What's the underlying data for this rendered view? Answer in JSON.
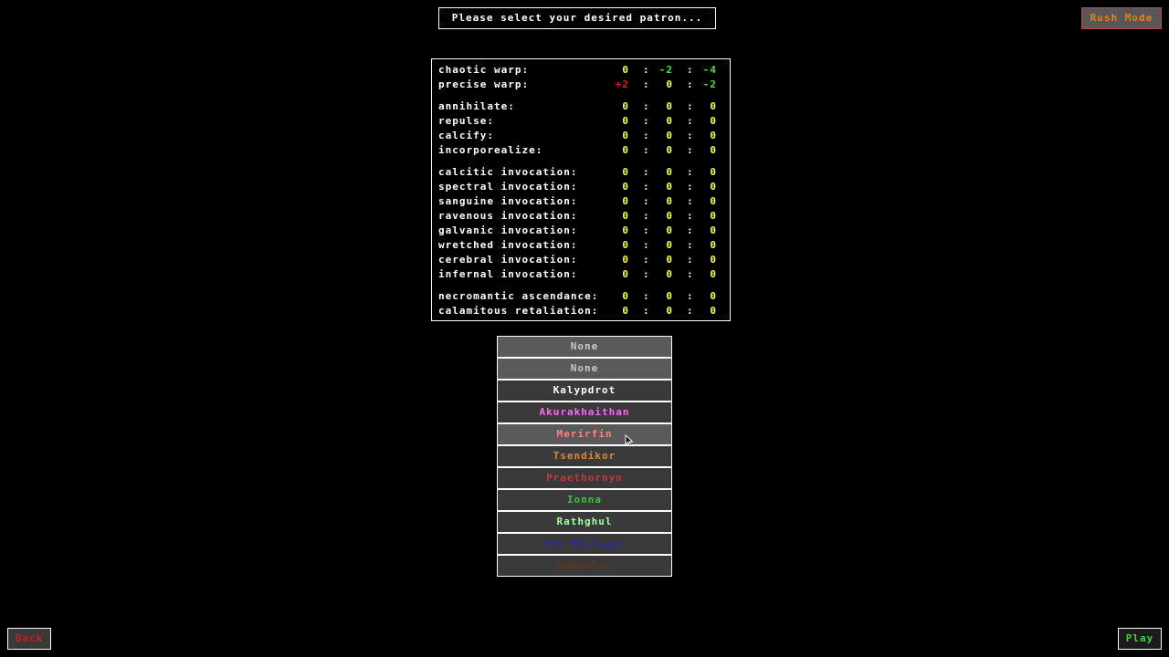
{
  "header": {
    "prompt": "Please select your desired patron...",
    "rush_mode_label": "Rush Mode"
  },
  "colors": {
    "zero": "#ffff40",
    "positive": "#e02020",
    "negative": "#40e040",
    "label": "#ffffff"
  },
  "stats": [
    {
      "label": "chaotic warp:",
      "values": [
        "0",
        "-2",
        "-4"
      ]
    },
    {
      "label": "precise warp:",
      "values": [
        "+2",
        "0",
        "-2"
      ]
    },
    {
      "label": "annihilate:",
      "values": [
        "0",
        "0",
        "0"
      ]
    },
    {
      "label": "repulse:",
      "values": [
        "0",
        "0",
        "0"
      ]
    },
    {
      "label": "calcify:",
      "values": [
        "0",
        "0",
        "0"
      ]
    },
    {
      "label": "incorporealize:",
      "values": [
        "0",
        "0",
        "0"
      ]
    },
    {
      "label": "calcitic invocation:",
      "values": [
        "0",
        "0",
        "0"
      ]
    },
    {
      "label": "spectral invocation:",
      "values": [
        "0",
        "0",
        "0"
      ]
    },
    {
      "label": "sanguine invocation:",
      "values": [
        "0",
        "0",
        "0"
      ]
    },
    {
      "label": "ravenous invocation:",
      "values": [
        "0",
        "0",
        "0"
      ]
    },
    {
      "label": "galvanic invocation:",
      "values": [
        "0",
        "0",
        "0"
      ]
    },
    {
      "label": "wretched invocation:",
      "values": [
        "0",
        "0",
        "0"
      ]
    },
    {
      "label": "cerebral invocation:",
      "values": [
        "0",
        "0",
        "0"
      ]
    },
    {
      "label": "infernal invocation:",
      "values": [
        "0",
        "0",
        "0"
      ]
    },
    {
      "label": "necromantic ascendance:",
      "values": [
        "0",
        "0",
        "0"
      ]
    },
    {
      "label": "calamitous retaliation:",
      "values": [
        "0",
        "0",
        "0"
      ]
    }
  ],
  "separator": ":",
  "patrons": [
    {
      "name": "None",
      "color": "#c8c8c8",
      "light": true
    },
    {
      "name": "None",
      "color": "#c8c8c8",
      "light": true
    },
    {
      "name": "Kalypdrot",
      "color": "#ffffff",
      "light": false
    },
    {
      "name": "Akurakhaithan",
      "color": "#f070f0",
      "light": false
    },
    {
      "name": "Merirfin",
      "color": "#ff8080",
      "light": true
    },
    {
      "name": "Tsendikor",
      "color": "#d08a40",
      "light": false
    },
    {
      "name": "Praethornyn",
      "color": "#c03838",
      "light": false
    },
    {
      "name": "Ionna",
      "color": "#40c040",
      "light": false
    },
    {
      "name": "Rathghul",
      "color": "#a0ffa0",
      "light": false
    },
    {
      "name": "The Muilager",
      "color": "#2828a8",
      "light": false
    },
    {
      "name": "Sudoolor",
      "color": "#603818",
      "light": false
    }
  ],
  "footer": {
    "back_label": "Back",
    "play_label": "Play"
  }
}
